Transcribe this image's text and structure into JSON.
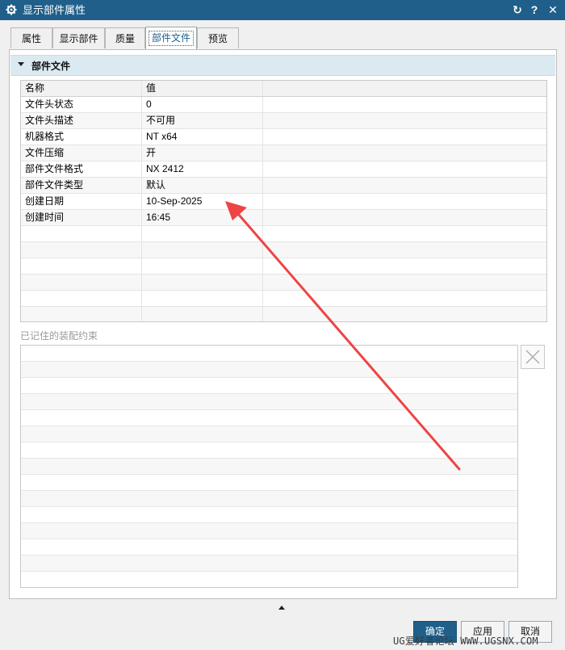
{
  "window": {
    "title": "显示部件属性",
    "refresh_glyph": "↻",
    "help_glyph": "?",
    "close_glyph": "✕"
  },
  "tabs": [
    {
      "label": "属性",
      "active": false
    },
    {
      "label": "显示部件",
      "active": false
    },
    {
      "label": "质量",
      "active": false
    },
    {
      "label": "部件文件",
      "active": true
    },
    {
      "label": "预览",
      "active": false
    }
  ],
  "group": {
    "title": "部件文件",
    "expanded": true
  },
  "properties": {
    "headers": [
      "名称",
      "值"
    ],
    "rows": [
      {
        "name": "文件头状态",
        "value": "0"
      },
      {
        "name": "文件头描述",
        "value": "不可用"
      },
      {
        "name": "机器格式",
        "value": "NT x64"
      },
      {
        "name": "文件压缩",
        "value": "开"
      },
      {
        "name": "部件文件格式",
        "value": "NX 2412"
      },
      {
        "name": "部件文件类型",
        "value": "默认"
      },
      {
        "name": "创建日期",
        "value": "10-Sep-2025"
      },
      {
        "name": "创建时间",
        "value": "16:45"
      }
    ]
  },
  "constraints": {
    "label": "已记住的装配约束",
    "items": []
  },
  "footer": {
    "ok_label": "确定",
    "apply_label": "应用",
    "cancel_label": "取消"
  },
  "watermark": "UG爱好者论坛 WWW.UGSNX.COM",
  "colors": {
    "titlebar": "#1f5f8a",
    "group_header": "#dbe9f1",
    "annotation_arrow": "#ee4444",
    "active_tab_text": "#1a5e8f"
  },
  "icons": [
    "gear-icon",
    "refresh-icon",
    "help-icon",
    "close-icon",
    "caret-down-icon",
    "delete-x-icon",
    "collapse-up-icon",
    "annotation-arrow"
  ]
}
